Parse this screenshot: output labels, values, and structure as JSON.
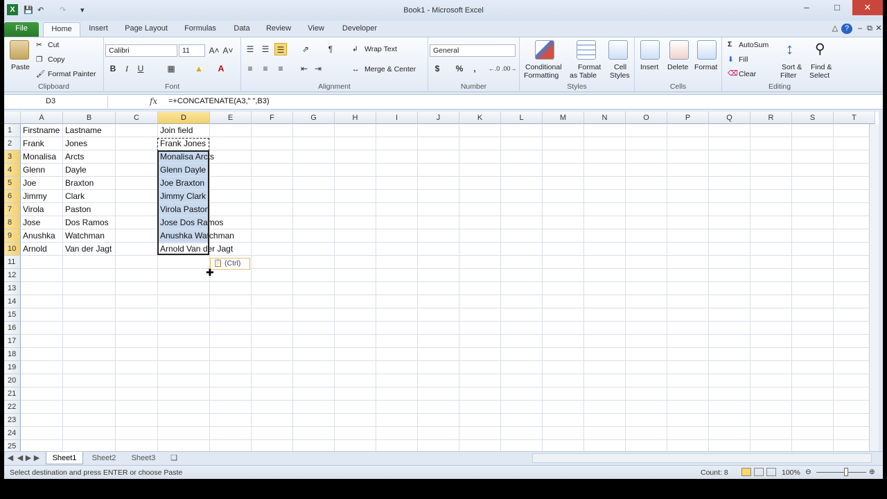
{
  "window": {
    "title": "Book1 - Microsoft Excel"
  },
  "tabs": [
    "File",
    "Home",
    "Insert",
    "Page Layout",
    "Formulas",
    "Data",
    "Review",
    "View",
    "Developer"
  ],
  "ribbon": {
    "clipboard": {
      "paste": "Paste",
      "cut": "Cut",
      "copy": "Copy",
      "format_painter": "Format Painter",
      "label": "Clipboard"
    },
    "font": {
      "name": "Calibri",
      "size": "11",
      "bold": "B",
      "italic": "I",
      "underline": "U",
      "label": "Font"
    },
    "alignment": {
      "wrap": "Wrap Text",
      "merge": "Merge & Center",
      "label": "Alignment"
    },
    "number": {
      "format": "General",
      "currency": "$",
      "percent": "%",
      "comma": ",",
      "label": "Number"
    },
    "styles": {
      "conditional": "Conditional",
      "conditional2": "Formatting",
      "format_table": "Format",
      "format_table2": "as Table",
      "cell_styles": "Cell",
      "cell_styles2": "Styles",
      "label": "Styles"
    },
    "cells": {
      "insert": "Insert",
      "delete": "Delete",
      "format": "Format",
      "label": "Cells"
    },
    "editing": {
      "autosum": "AutoSum",
      "fill": "Fill",
      "clear": "Clear",
      "sort": "Sort &",
      "sort2": "Filter",
      "find": "Find &",
      "find2": "Select",
      "label": "Editing"
    }
  },
  "formula_bar": {
    "name_box": "D3",
    "fx": "fx",
    "formula": "=+CONCATENATE(A3,\" \",B3)"
  },
  "columns": [
    "A",
    "B",
    "C",
    "D",
    "E",
    "F",
    "G",
    "H",
    "I",
    "J",
    "K",
    "L",
    "M",
    "N",
    "O",
    "P",
    "Q",
    "R",
    "S",
    "T"
  ],
  "rows": [
    "1",
    "2",
    "3",
    "4",
    "5",
    "6",
    "7",
    "8",
    "9",
    "10",
    "11",
    "12",
    "13",
    "14",
    "15",
    "16",
    "17",
    "18",
    "19",
    "20",
    "21",
    "22",
    "23",
    "24",
    "25"
  ],
  "cells": {
    "A": [
      "Firstname",
      "Frank",
      "Monalisa",
      "Glenn",
      "Joe",
      "Jimmy",
      "Virola",
      "Jose",
      "Anushka",
      "Arnold"
    ],
    "B": [
      "Lastname",
      "Jones",
      "Arcts",
      "Dayle",
      "Braxton",
      "Clark",
      "Paston",
      "Dos Ramos",
      "Watchman",
      "Van der Jagt"
    ],
    "D": [
      "Join field",
      "Frank Jones",
      "Monalisa Arcts",
      "Glenn Dayle",
      "Joe  Braxton",
      "Jimmy Clark",
      "Virola Paston",
      "Jose Dos Ramos",
      "Anushka Watchman",
      "Arnold Van der Jagt"
    ]
  },
  "paste_options": "(Ctrl)",
  "sheets": [
    "Sheet1",
    "Sheet2",
    "Sheet3"
  ],
  "status": {
    "message": "Select destination and press ENTER or choose Paste",
    "count": "Count: 8",
    "zoom": "100%"
  }
}
